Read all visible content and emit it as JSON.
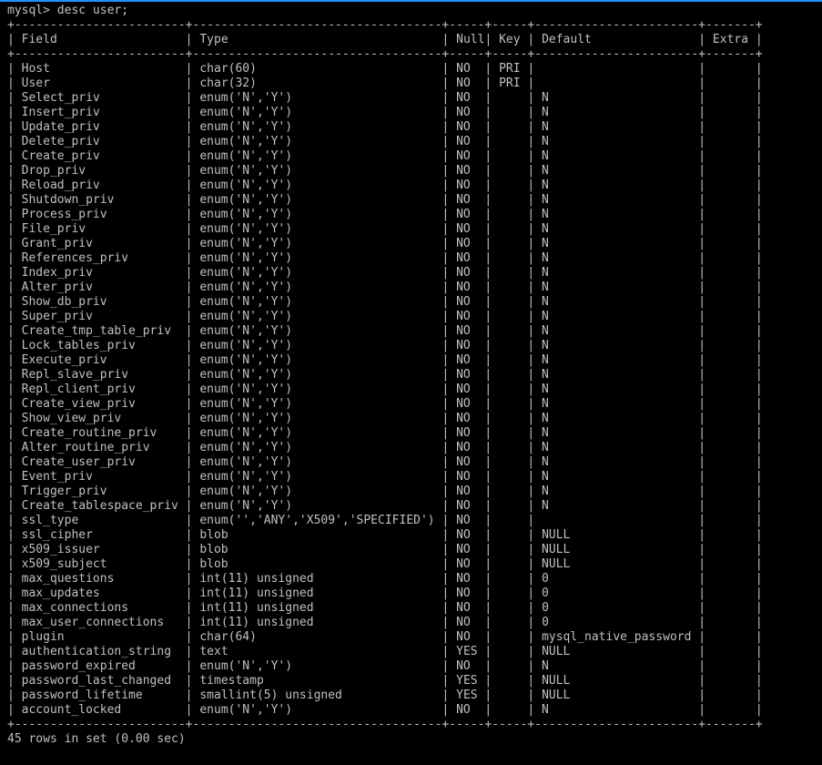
{
  "terminal": {
    "prompt": "mysql> desc user;",
    "footer": "45 rows in set (0.00 sec)",
    "headers": [
      "Field",
      "Type",
      "Null",
      "Key",
      "Default",
      "Extra"
    ],
    "rows": [
      [
        "Host",
        "char(60)",
        "NO",
        "PRI",
        "",
        ""
      ],
      [
        "User",
        "char(32)",
        "NO",
        "PRI",
        "",
        ""
      ],
      [
        "Select_priv",
        "enum('N','Y')",
        "NO",
        "",
        "N",
        ""
      ],
      [
        "Insert_priv",
        "enum('N','Y')",
        "NO",
        "",
        "N",
        ""
      ],
      [
        "Update_priv",
        "enum('N','Y')",
        "NO",
        "",
        "N",
        ""
      ],
      [
        "Delete_priv",
        "enum('N','Y')",
        "NO",
        "",
        "N",
        ""
      ],
      [
        "Create_priv",
        "enum('N','Y')",
        "NO",
        "",
        "N",
        ""
      ],
      [
        "Drop_priv",
        "enum('N','Y')",
        "NO",
        "",
        "N",
        ""
      ],
      [
        "Reload_priv",
        "enum('N','Y')",
        "NO",
        "",
        "N",
        ""
      ],
      [
        "Shutdown_priv",
        "enum('N','Y')",
        "NO",
        "",
        "N",
        ""
      ],
      [
        "Process_priv",
        "enum('N','Y')",
        "NO",
        "",
        "N",
        ""
      ],
      [
        "File_priv",
        "enum('N','Y')",
        "NO",
        "",
        "N",
        ""
      ],
      [
        "Grant_priv",
        "enum('N','Y')",
        "NO",
        "",
        "N",
        ""
      ],
      [
        "References_priv",
        "enum('N','Y')",
        "NO",
        "",
        "N",
        ""
      ],
      [
        "Index_priv",
        "enum('N','Y')",
        "NO",
        "",
        "N",
        ""
      ],
      [
        "Alter_priv",
        "enum('N','Y')",
        "NO",
        "",
        "N",
        ""
      ],
      [
        "Show_db_priv",
        "enum('N','Y')",
        "NO",
        "",
        "N",
        ""
      ],
      [
        "Super_priv",
        "enum('N','Y')",
        "NO",
        "",
        "N",
        ""
      ],
      [
        "Create_tmp_table_priv",
        "enum('N','Y')",
        "NO",
        "",
        "N",
        ""
      ],
      [
        "Lock_tables_priv",
        "enum('N','Y')",
        "NO",
        "",
        "N",
        ""
      ],
      [
        "Execute_priv",
        "enum('N','Y')",
        "NO",
        "",
        "N",
        ""
      ],
      [
        "Repl_slave_priv",
        "enum('N','Y')",
        "NO",
        "",
        "N",
        ""
      ],
      [
        "Repl_client_priv",
        "enum('N','Y')",
        "NO",
        "",
        "N",
        ""
      ],
      [
        "Create_view_priv",
        "enum('N','Y')",
        "NO",
        "",
        "N",
        ""
      ],
      [
        "Show_view_priv",
        "enum('N','Y')",
        "NO",
        "",
        "N",
        ""
      ],
      [
        "Create_routine_priv",
        "enum('N','Y')",
        "NO",
        "",
        "N",
        ""
      ],
      [
        "Alter_routine_priv",
        "enum('N','Y')",
        "NO",
        "",
        "N",
        ""
      ],
      [
        "Create_user_priv",
        "enum('N','Y')",
        "NO",
        "",
        "N",
        ""
      ],
      [
        "Event_priv",
        "enum('N','Y')",
        "NO",
        "",
        "N",
        ""
      ],
      [
        "Trigger_priv",
        "enum('N','Y')",
        "NO",
        "",
        "N",
        ""
      ],
      [
        "Create_tablespace_priv",
        "enum('N','Y')",
        "NO",
        "",
        "N",
        ""
      ],
      [
        "ssl_type",
        "enum('','ANY','X509','SPECIFIED')",
        "NO",
        "",
        "",
        ""
      ],
      [
        "ssl_cipher",
        "blob",
        "NO",
        "",
        "NULL",
        ""
      ],
      [
        "x509_issuer",
        "blob",
        "NO",
        "",
        "NULL",
        ""
      ],
      [
        "x509_subject",
        "blob",
        "NO",
        "",
        "NULL",
        ""
      ],
      [
        "max_questions",
        "int(11) unsigned",
        "NO",
        "",
        "0",
        ""
      ],
      [
        "max_updates",
        "int(11) unsigned",
        "NO",
        "",
        "0",
        ""
      ],
      [
        "max_connections",
        "int(11) unsigned",
        "NO",
        "",
        "0",
        ""
      ],
      [
        "max_user_connections",
        "int(11) unsigned",
        "NO",
        "",
        "0",
        ""
      ],
      [
        "plugin",
        "char(64)",
        "NO",
        "",
        "mysql_native_password",
        ""
      ],
      [
        "authentication_string",
        "text",
        "YES",
        "",
        "NULL",
        ""
      ],
      [
        "password_expired",
        "enum('N','Y')",
        "NO",
        "",
        "N",
        ""
      ],
      [
        "password_last_changed",
        "timestamp",
        "YES",
        "",
        "NULL",
        ""
      ],
      [
        "password_lifetime",
        "smallint(5) unsigned",
        "YES",
        "",
        "NULL",
        ""
      ],
      [
        "account_locked",
        "enum('N','Y')",
        "NO",
        "",
        "N",
        ""
      ]
    ]
  },
  "colors": {
    "background": "#000000",
    "text": "#c0c0c0",
    "accent": "#1e90ff"
  }
}
